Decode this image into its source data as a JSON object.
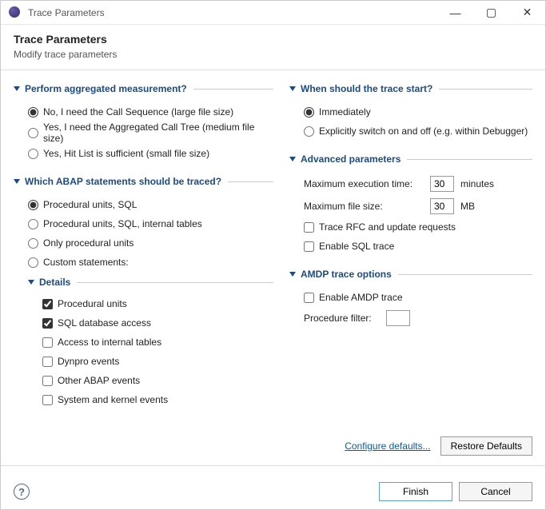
{
  "window": {
    "title": "Trace Parameters"
  },
  "header": {
    "title": "Trace Parameters",
    "subtitle": "Modify trace parameters"
  },
  "aggregated": {
    "title": "Perform aggregated measurement?",
    "options": {
      "no": "No, I need the Call Sequence (large file size)",
      "yes_tree": "Yes, I need the Aggregated Call Tree (medium file size)",
      "yes_hitlist": "Yes, Hit List is sufficient (small file size)"
    }
  },
  "abap": {
    "title": "Which ABAP statements should be traced?",
    "options": {
      "psql": "Procedural units, SQL",
      "psql_int": "Procedural units, SQL, internal tables",
      "ponly": "Only procedural units",
      "custom": "Custom statements:"
    }
  },
  "details": {
    "title": "Details",
    "items": {
      "procedural": "Procedural units",
      "sqldb": "SQL database access",
      "internal": "Access to internal tables",
      "dynpro": "Dynpro events",
      "otherabap": "Other ABAP events",
      "syskernel": "System and kernel events"
    }
  },
  "tracestart": {
    "title": "When should the trace start?",
    "options": {
      "immediate": "Immediately",
      "explicit": "Explicitly switch on and off (e.g. within Debugger)"
    }
  },
  "advanced": {
    "title": "Advanced parameters",
    "maxtime_label": "Maximum execution time:",
    "maxtime_value": "30",
    "maxtime_unit": "minutes",
    "maxsize_label": "Maximum file size:",
    "maxsize_value": "30",
    "maxsize_unit": "MB",
    "tracerfc": "Trace RFC and update requests",
    "enablesql": "Enable SQL trace"
  },
  "amdp": {
    "title": "AMDP trace options",
    "enable": "Enable AMDP trace",
    "filter_label": "Procedure filter:"
  },
  "footer": {
    "configure": "Configure defaults...",
    "restore": "Restore Defaults",
    "finish": "Finish",
    "cancel": "Cancel"
  },
  "help_char": "?"
}
